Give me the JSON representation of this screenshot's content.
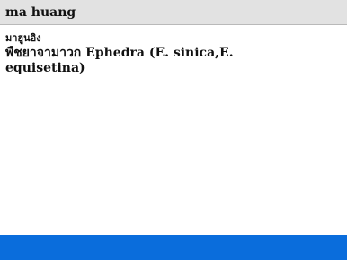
{
  "search": {
    "value": "ma huang"
  },
  "entry": {
    "headword": "มาฮูนอิง",
    "definition": "พืชยาจามาวก Ephedra (E. sinica,E. equisetina)"
  },
  "colors": {
    "header_bg": "#e2e2e2",
    "status_bar": "#0a6ddc"
  }
}
